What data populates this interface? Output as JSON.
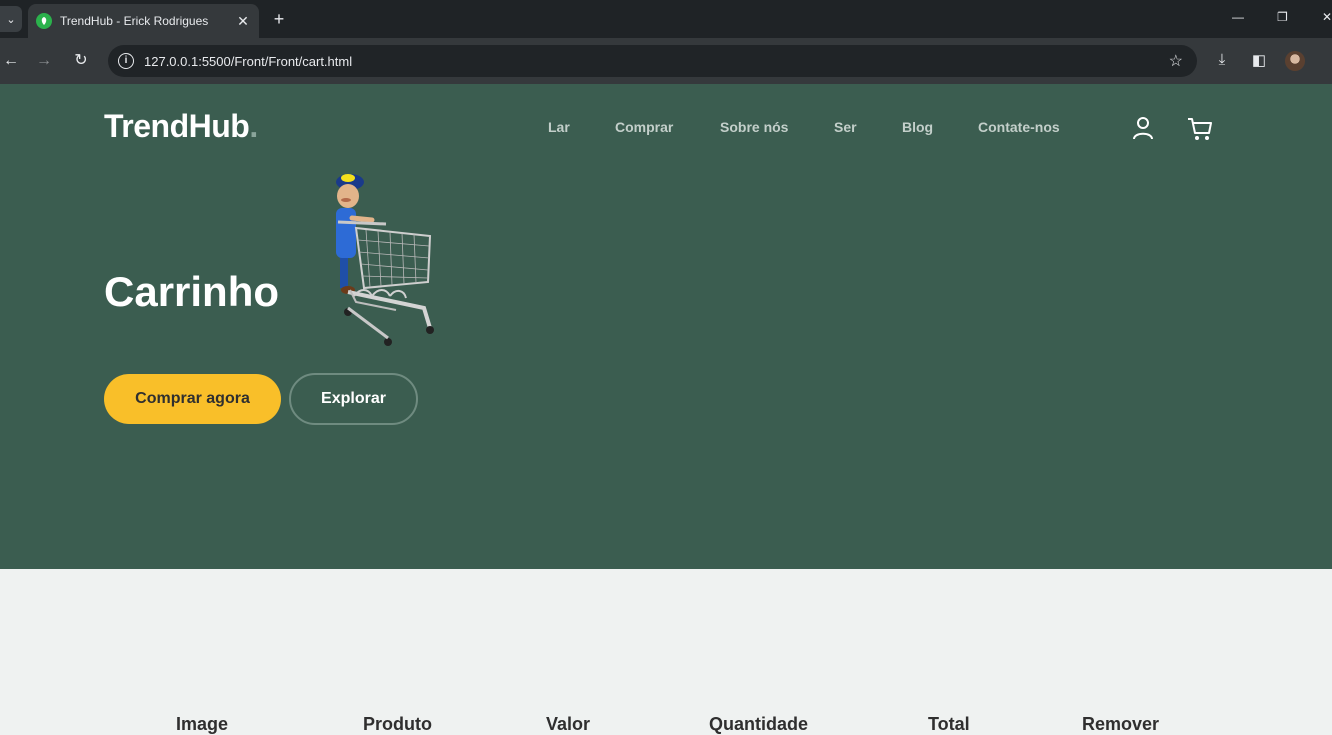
{
  "browser": {
    "tab_title": "TrendHub - Erick Rodrigues",
    "url": "127.0.0.1:5500/Front/Front/cart.html"
  },
  "header": {
    "logo_text": "TrendHub",
    "logo_dot": ".",
    "nav": [
      "Lar",
      "Comprar",
      "Sobre nós",
      "Ser",
      "Blog",
      "Contate-nos"
    ]
  },
  "hero": {
    "title": "Carrinho",
    "primary_button": "Comprar agora",
    "secondary_button": "Explorar"
  },
  "cart_table": {
    "headers": [
      "Image",
      "Produto",
      "Valor",
      "Quantidade",
      "Total",
      "Remover"
    ]
  },
  "colors": {
    "hero_bg": "#3b5d50",
    "accent": "#f9bf29",
    "page_bg": "#eff2f1"
  }
}
